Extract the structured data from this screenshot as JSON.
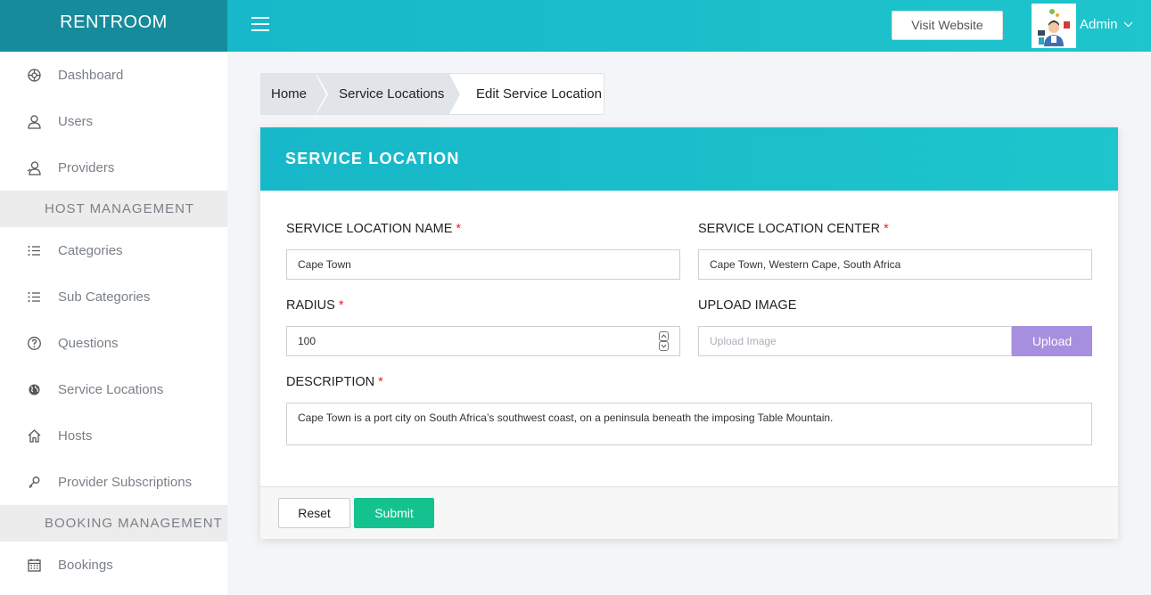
{
  "brand": {
    "name": "RENTROOM"
  },
  "topbar": {
    "visit_label": "Visit Website",
    "user_name": "Admin"
  },
  "sidebar": {
    "items": [
      {
        "label": "Dashboard",
        "icon": "dashboard-icon"
      },
      {
        "label": "Users",
        "icon": "user-icon"
      },
      {
        "label": "Providers",
        "icon": "providers-icon"
      }
    ],
    "section_host": "HOST MANAGEMENT",
    "host_items": [
      {
        "label": "Categories",
        "icon": "list-icon"
      },
      {
        "label": "Sub Categories",
        "icon": "list-icon"
      },
      {
        "label": "Questions",
        "icon": "question-icon"
      },
      {
        "label": "Service Locations",
        "icon": "globe-icon"
      },
      {
        "label": "Hosts",
        "icon": "home-icon"
      },
      {
        "label": "Provider Subscriptions",
        "icon": "key-icon"
      }
    ],
    "section_booking": "BOOKING MANAGEMENT",
    "booking_items": [
      {
        "label": "Bookings",
        "icon": "calendar-icon"
      }
    ]
  },
  "breadcrumb": [
    "Home",
    "Service Locations",
    "Edit Service Location"
  ],
  "form": {
    "title": "SERVICE LOCATION",
    "name_label": "SERVICE LOCATION NAME",
    "name_value": "Cape Town",
    "center_label": "SERVICE LOCATION CENTER",
    "center_value": "Cape Town, Western Cape, South Africa",
    "radius_label": "RADIUS",
    "radius_value": "100",
    "upload_label": "UPLOAD IMAGE",
    "upload_placeholder": "Upload Image",
    "upload_button": "Upload",
    "description_label": "DESCRIPTION",
    "description_value": "Cape Town is a port city on South Africa’s southwest coast, on a peninsula beneath the imposing Table Mountain.",
    "required_mark": "*",
    "reset_label": "Reset",
    "submit_label": "Submit"
  },
  "colors": {
    "topbar": "#1bbfca",
    "brand_bg": "#158b9c",
    "submit": "#14c28f",
    "upload": "#a58fde",
    "required": "#e0262b"
  }
}
